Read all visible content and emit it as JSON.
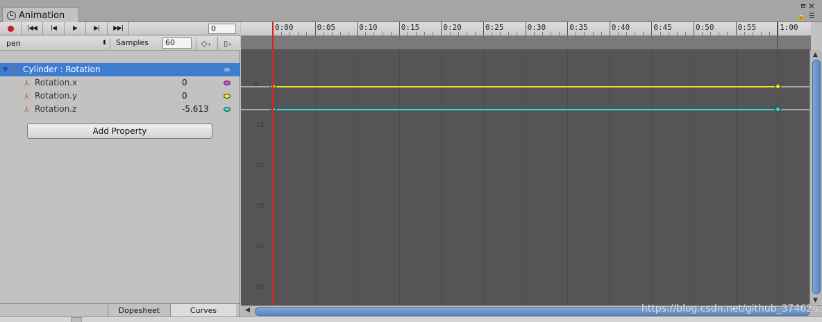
{
  "window": {
    "tab_title": "Animation"
  },
  "toolbar": {
    "record_icon": "record-icon",
    "buttons": [
      "first-key",
      "prev-key",
      "play",
      "next-key",
      "last-key"
    ],
    "frame": "0"
  },
  "clip": {
    "name": "pen",
    "samples_label": "Samples",
    "samples": "60"
  },
  "properties": {
    "group": {
      "label": "Cylinder : Rotation"
    },
    "items": [
      {
        "label": "Rotation.x",
        "value": "0",
        "color": "#e040e0"
      },
      {
        "label": "Rotation.y",
        "value": "0",
        "color": "#e8e820"
      },
      {
        "label": "Rotation.z",
        "value": "-5.613",
        "color": "#30d8e0"
      }
    ],
    "add_property": "Add Property"
  },
  "bottom_tabs": {
    "dopesheet": "Dopesheet",
    "curves": "Curves",
    "active": "Curves"
  },
  "timeline": {
    "ticks": [
      "0:00",
      "0:05",
      "0:10",
      "0:15",
      "0:20",
      "0:25",
      "0:30",
      "0:35",
      "0:40",
      "0:45",
      "0:50",
      "0:55",
      "1:00"
    ],
    "y_labels": [
      "0",
      "-10",
      "-20",
      "-30",
      "-40",
      "-50"
    ],
    "playhead_frame": "0:00"
  },
  "curves": [
    {
      "name": "Rotation.y",
      "color": "#e8e820",
      "value": 0
    },
    {
      "name": "Rotation.z",
      "color": "#30d8e0",
      "value": -5.613
    }
  ],
  "watermark": "https://blog.csdn.net/github_37462634"
}
